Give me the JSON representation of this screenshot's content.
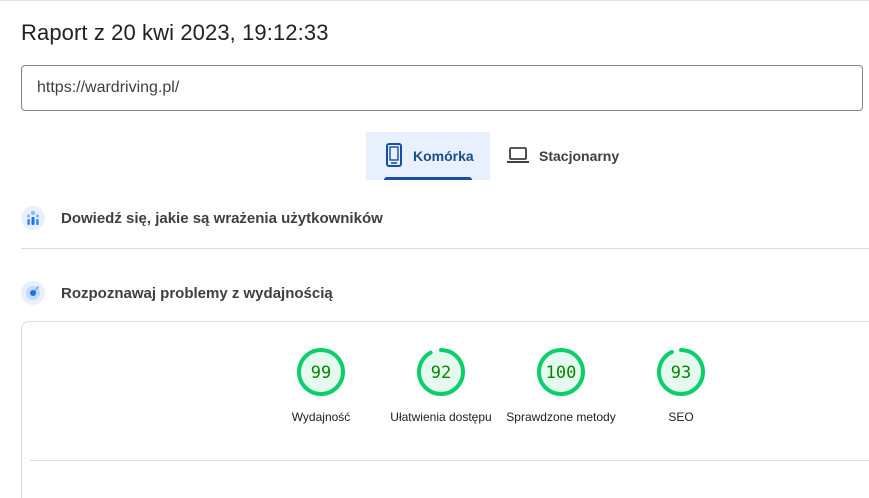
{
  "report": {
    "title": "Raport z 20 kwi 2023, 19:12:33",
    "url": "https://wardriving.pl/"
  },
  "tabs": [
    {
      "label": "Komórka",
      "icon": "smartphone-icon",
      "active": true
    },
    {
      "label": "Stacjonarny",
      "icon": "laptop-icon",
      "active": false
    }
  ],
  "sections": {
    "field_data": {
      "label": "Dowiedź się, jakie są wrażenia użytkowników",
      "icon": "users-experience-icon"
    },
    "lab_data": {
      "label": "Rozpoznawaj problemy z wydajnością",
      "icon": "performance-diagnose-icon"
    }
  },
  "scores": [
    {
      "value": "99",
      "fraction": 0.99,
      "label": "Wydajność"
    },
    {
      "value": "92",
      "fraction": 0.92,
      "label": "Ułatwienia dostępu"
    },
    {
      "value": "100",
      "fraction": 1.0,
      "label": "Sprawdzone metody"
    },
    {
      "value": "93",
      "fraction": 0.93,
      "label": "SEO"
    }
  ],
  "colors": {
    "pass": "#0cce6b",
    "pass_text": "#008800",
    "pass_bg": "#e6f9ef",
    "tab_active_bg": "#e8f0fe",
    "tab_active_text": "#174ea6"
  }
}
